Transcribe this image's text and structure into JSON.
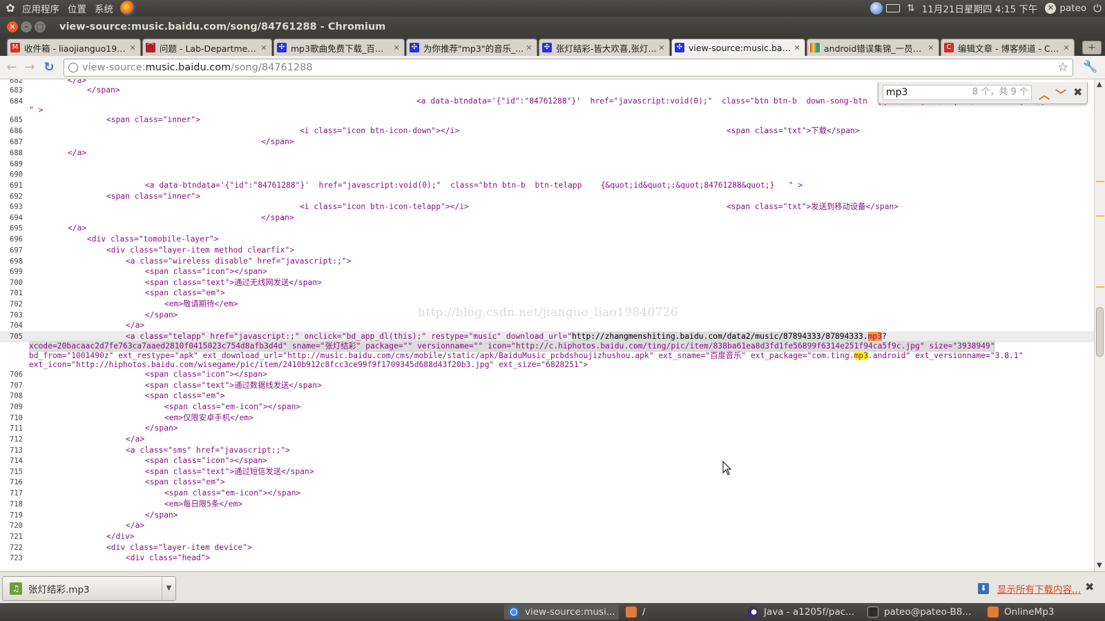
{
  "top_panel": {
    "menus": [
      "应用程序",
      "位置",
      "系统"
    ],
    "datetime": "11月21日星期四 4:15 下午",
    "user": "pateo"
  },
  "window": {
    "title": "view-source:music.baidu.com/song/84761288 - Chromium"
  },
  "tabs": [
    {
      "label": "收件箱 - liaojianguo198...",
      "icon": "gmail-icon",
      "color": "#d93025"
    },
    {
      "label": "问题 - Lab-Department ...",
      "icon": "redmine-icon",
      "color": "#b32024"
    },
    {
      "label": "mp3歌曲免费下载_百度...",
      "icon": "baidu-icon",
      "color": "#2932e1"
    },
    {
      "label": "为你推荐\"mp3\"的音乐_...",
      "icon": "baidu-icon",
      "color": "#2932e1"
    },
    {
      "label": "张灯结彩-皆大欢喜,张灯...",
      "icon": "baidu-icon",
      "color": "#2932e1"
    },
    {
      "label": "view-source:music.baid...",
      "icon": "baidu-icon",
      "color": "#2932e1",
      "active": true
    },
    {
      "label": "android错误集锦_一员程...",
      "icon": "colorful-icon",
      "color": "#e8a317"
    },
    {
      "label": "编辑文章 - 博客频道 - CS...",
      "icon": "csdn-icon",
      "color": "#c9302c"
    }
  ],
  "omnibox": {
    "prefix": "view-source:",
    "host": "music.baidu.com",
    "path": "/song/84761288"
  },
  "find_bar": {
    "query": "mp3",
    "count": "8 个，共 9 个"
  },
  "watermark": "http://blog.csdn.net/jianguo_liao19840726",
  "source_lines": {
    "l682": {
      "n": "682",
      "c": "</a>"
    },
    "l683": {
      "n": "683",
      "c": "</span>"
    },
    "l684": {
      "n": "684",
      "c1": "<a data-btndata='{\"id\":\"84761288\"}'  href=\"javascript:void(0);\"  class=\"btn btn-b  down-song-btn  {quot;id&quot;:&quot;84761288&quot;}",
      "c2": "\" >"
    },
    "l685": {
      "n": "685",
      "c": "<span class=\"inner\">"
    },
    "l686": {
      "n": "686",
      "a": "<i class=\"icon btn-icon-down\"></i>",
      "b": "<span class=\"txt\">下载</span>"
    },
    "l687": {
      "n": "687",
      "c": "</span>"
    },
    "l688": {
      "n": "688",
      "c": "</a>"
    },
    "l689": {
      "n": "689"
    },
    "l690": {
      "n": "690"
    },
    "l691": {
      "n": "691",
      "c": "<a data-btndata='{\"id\":\"84761288\"}'  href=\"javascript:void(0);\"  class=\"btn btn-b  btn-telapp    {&quot;id&quot;:&quot;84761288&quot;}   \" >"
    },
    "l692": {
      "n": "692",
      "c": "<span class=\"inner\">"
    },
    "l693": {
      "n": "693",
      "a": "<i class=\"icon btn-icon-telapp\"></i>",
      "b": "<span class=\"txt\">发送到移动设备</span>"
    },
    "l694": {
      "n": "694",
      "c": "</span>"
    },
    "l695": {
      "n": "695",
      "c": "</a>"
    },
    "l696": {
      "n": "696",
      "c": "<div class=\"tomobile-layer\">"
    },
    "l697": {
      "n": "697",
      "c": "<div class=\"layer-item method clearfix\">"
    },
    "l698": {
      "n": "698",
      "c": "<a class=\"wireless disable\" href=\"javascript:;\">"
    },
    "l699": {
      "n": "699",
      "c": "<span class=\"icon\"></span>"
    },
    "l700": {
      "n": "700",
      "c": "<span class=\"text\">通过无线网发送</span>"
    },
    "l701": {
      "n": "701",
      "c": "<span class=\"em\">"
    },
    "l702": {
      "n": "702",
      "c": "<em>敬请期待</em>"
    },
    "l703": {
      "n": "703",
      "c": "</span>"
    },
    "l704": {
      "n": "704",
      "c": "</a>"
    },
    "l705": {
      "n": "705",
      "c1": "<a class=\"telapp\" href=\"javascript:;\" onclick=\"bd_app_dl(this);\" restype=\"music\" download_url=\"",
      "c1url": "http://zhangmenshiting.baidu.com/data2/music/87894333/87894333.",
      "c1mp3": "mp3",
      "c1end": "?",
      "c2": "xcode=20bacaac2d7fe763ca7aaed2810f0415023c754d8afb3d4d\" sname=\"张灯结彩\" package=\"\" versionname=\"\" icon=\"http://c.hiphotos.baidu.com/ting/pic/item/838ba61ea8d3fd1fe56899f6314e251f94ca5f9c.jpg\" size=\"3938949\"",
      "c3a": "bd_from=\"1001490z\" ext_restype=\"apk\" ext_download_url=\"http://music.baidu.com/cms/mobile/static/apk/BaiduMusic_pcbdshoujizhushou.apk\" ext_sname=\"百度音乐\" ext_package=\"com.ting.",
      "c3mp3": "mp3",
      "c3b": ".android\" ext_versionname=\"3.8.1\"",
      "c4": "ext_icon=\"http://hiphotos.baidu.com/wisegame/pic/item/2410b912c8fcc3ce99f9f1709345d688d43f20b3.jpg\" ext_size=\"6828251\">"
    },
    "l706": {
      "n": "706",
      "c": "<span class=\"icon\"></span>"
    },
    "l707": {
      "n": "707",
      "c": "<span class=\"text\">通过数据线发送</span>"
    },
    "l708": {
      "n": "708",
      "c": "<span class=\"em\">"
    },
    "l709": {
      "n": "709",
      "c": "<span class=\"em-icon\"></span>"
    },
    "l710": {
      "n": "710",
      "c": "<em>仅限安卓手机</em>"
    },
    "l711": {
      "n": "711",
      "c": "</span>"
    },
    "l712": {
      "n": "712",
      "c": "</a>"
    },
    "l713": {
      "n": "713",
      "c": "<a class=\"sms\" href=\"javascript:;\">"
    },
    "l714": {
      "n": "714",
      "c": "<span class=\"icon\"></span>"
    },
    "l715": {
      "n": "715",
      "c": "<span class=\"text\">通过短信发送</span>"
    },
    "l716": {
      "n": "716",
      "c": "<span class=\"em\">"
    },
    "l717": {
      "n": "717",
      "c": "<span class=\"em-icon\"></span>"
    },
    "l718": {
      "n": "718",
      "c": "<em>每日限5条</em>"
    },
    "l719": {
      "n": "719",
      "c": "</span>"
    },
    "l720": {
      "n": "720",
      "c": "</a>"
    },
    "l721": {
      "n": "721",
      "c": "</div>"
    },
    "l722": {
      "n": "722",
      "c": "<div class=\"layer-item device\">"
    },
    "l723": {
      "n": "723",
      "c": "<div class=\"head\">"
    }
  },
  "download_shelf": {
    "file": "张灯结彩.mp3",
    "show_all": "显示所有下载内容..."
  },
  "taskbar": [
    {
      "label": "view-source:musi...",
      "icon": "chromium-icon",
      "active": true
    },
    {
      "label": "/",
      "icon": "folder-icon"
    },
    {
      "label": "Java - a1205f/pac...",
      "icon": "eclipse-icon"
    },
    {
      "label": "pateo@pateo-B8...",
      "icon": "terminal-icon"
    },
    {
      "label": "OnlineMp3",
      "icon": "folder-icon"
    }
  ]
}
